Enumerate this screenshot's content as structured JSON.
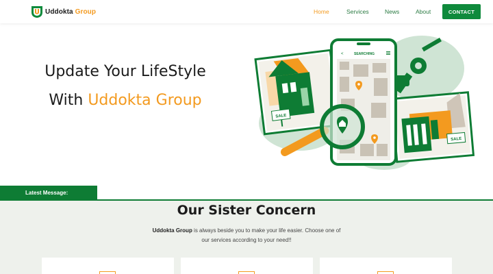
{
  "header": {
    "logo_text_dark": "Uddokta",
    "logo_text_accent": "Group",
    "nav": [
      {
        "label": "Home",
        "active": true
      },
      {
        "label": "Services",
        "active": false
      },
      {
        "label": "News",
        "active": false
      },
      {
        "label": "About",
        "active": false
      }
    ],
    "contact_label": "CONTACT"
  },
  "hero": {
    "line1": "Update Your LifeStyle",
    "line2_prefix": "With ",
    "line2_accent": "Uddokta Group",
    "phone_header": "SEARCHING",
    "sale_sign": "SALE"
  },
  "latest_message_label": "Latest Message:",
  "sister_concern": {
    "title": "Our Sister Concern",
    "desc_bold": "Uddokta Group",
    "desc_rest": " is always beside you to make your life easier. Choose one of our services according to your need!!"
  },
  "colors": {
    "brand_green": "#0f8a3c",
    "accent_orange": "#f39a1f",
    "section_bg": "#eef1ec"
  }
}
